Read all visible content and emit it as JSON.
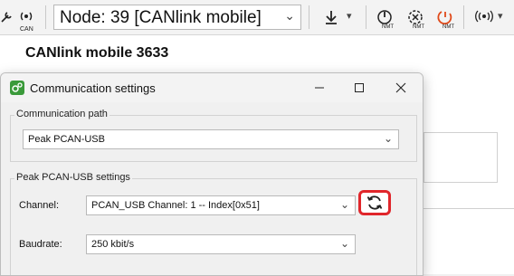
{
  "toolbar": {
    "can_label": "CAN",
    "node_select_value": "Node: 39 [CANlink mobile]",
    "nmt_label": "NMT"
  },
  "app": {
    "title": "CANlink mobile 3633"
  },
  "dialog": {
    "title": "Communication settings",
    "comm_path_group": "Communication path",
    "comm_path_value": "Peak PCAN-USB",
    "settings_group": "Peak PCAN-USB settings",
    "channel_label": "Channel:",
    "channel_value": "PCAN_USB Channel: 1  -- Index[0x51]",
    "baudrate_label": "Baudrate:",
    "baudrate_value": "250 kbit/s"
  },
  "colors": {
    "highlight": "#e0262b",
    "nmt_red": "#e04a1a"
  }
}
